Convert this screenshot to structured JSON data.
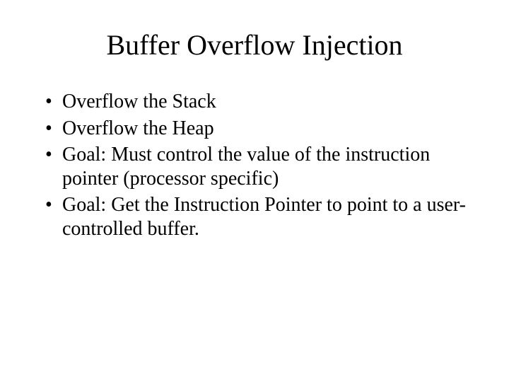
{
  "slide": {
    "title": "Buffer Overflow Injection",
    "bullets": [
      "Overflow the Stack",
      "Overflow the Heap",
      "Goal: Must control the value of the instruction pointer (processor specific)",
      "Goal: Get the Instruction Pointer to point to a user-controlled buffer."
    ]
  }
}
